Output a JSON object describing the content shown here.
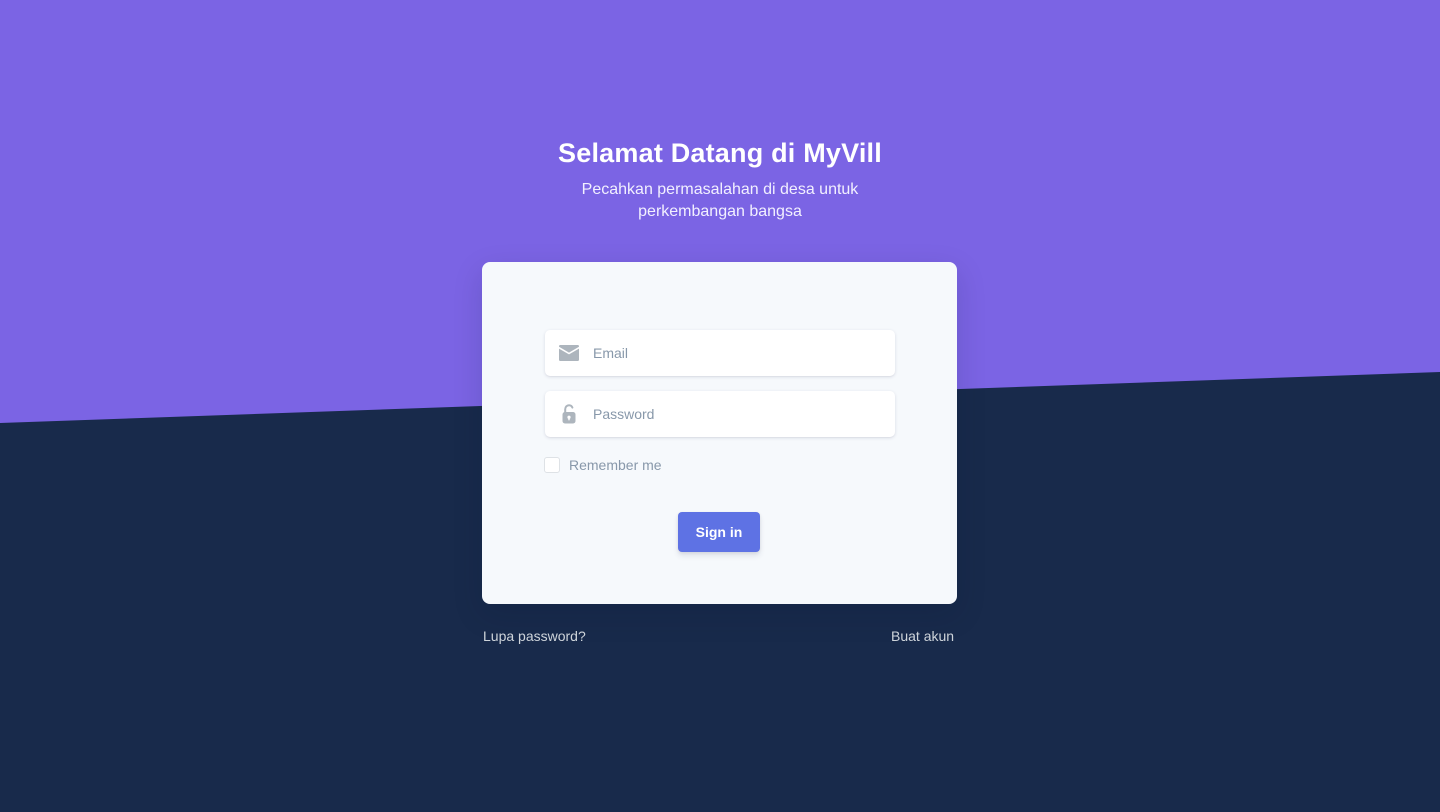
{
  "colors": {
    "background_top": "#7b64e4",
    "background_bottom": "#182a4b",
    "card": "#f6f9fc",
    "primary_button": "#5e72e4",
    "muted_text": "#8898aa"
  },
  "hero": {
    "title": "Selamat Datang di MyVill",
    "subtitle": "Pecahkan permasalahan di desa untuk perkembangan bangsa"
  },
  "login_form": {
    "email": {
      "icon": "envelope-icon",
      "placeholder": "Email",
      "value": ""
    },
    "password": {
      "icon": "lock-open-icon",
      "placeholder": "Password",
      "value": ""
    },
    "remember_me": {
      "label": "Remember me",
      "checked": false
    },
    "submit_label": "Sign in"
  },
  "footer_links": {
    "forgot_password": "Lupa password?",
    "create_account": "Buat akun"
  }
}
